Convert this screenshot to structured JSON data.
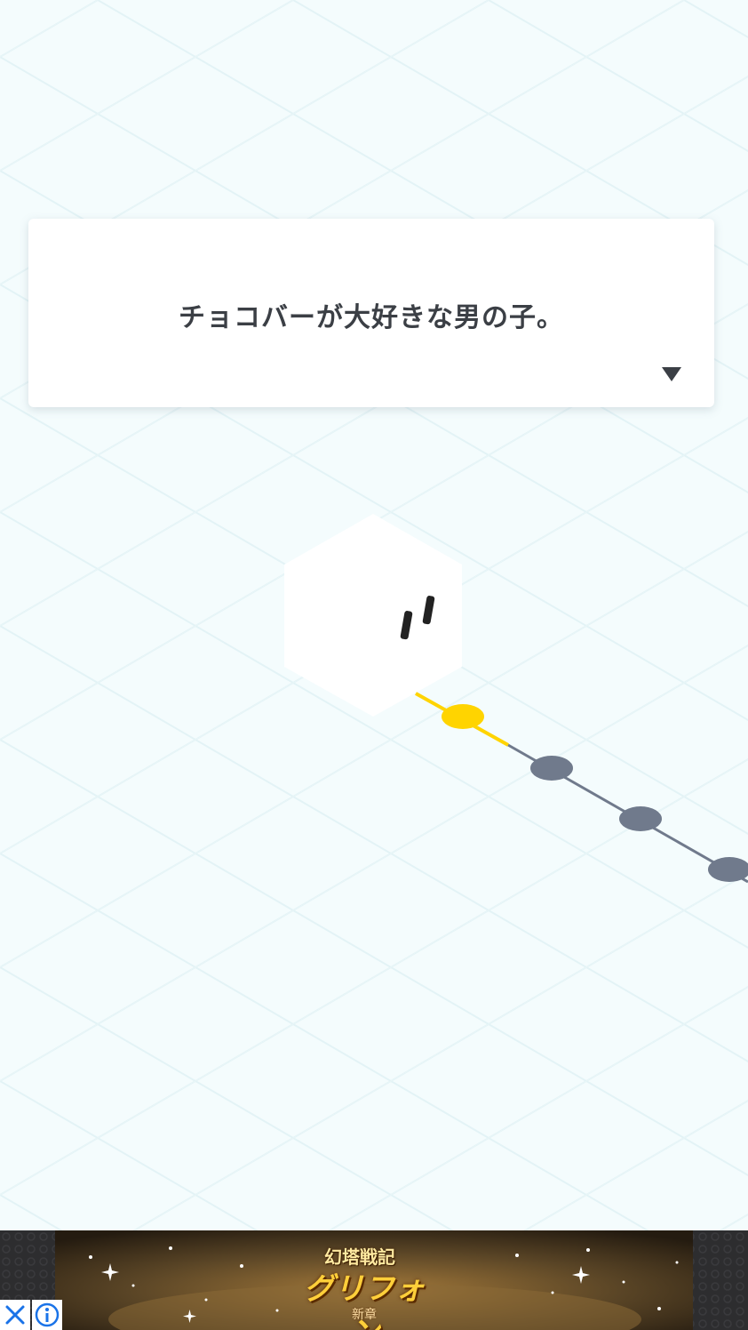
{
  "dialog": {
    "text": "チョコバーが大好きな男の子。",
    "next_icon": "triangle-down-icon"
  },
  "scene": {
    "character": "white-hexagon-character",
    "path_nodes": [
      {
        "state": "current",
        "color": "#ffd400"
      },
      {
        "state": "locked",
        "color": "#707a8c"
      },
      {
        "state": "locked",
        "color": "#707a8c"
      },
      {
        "state": "locked",
        "color": "#707a8c"
      }
    ],
    "colors": {
      "background": "#f4fcfd",
      "active_path": "#ffd400",
      "inactive_path": "#707a8c"
    }
  },
  "ad": {
    "title": "幻塔戦記",
    "logo": "グリフォン",
    "subtitle": "新章",
    "close_icon": "close-icon",
    "info_icon": "info-icon"
  }
}
